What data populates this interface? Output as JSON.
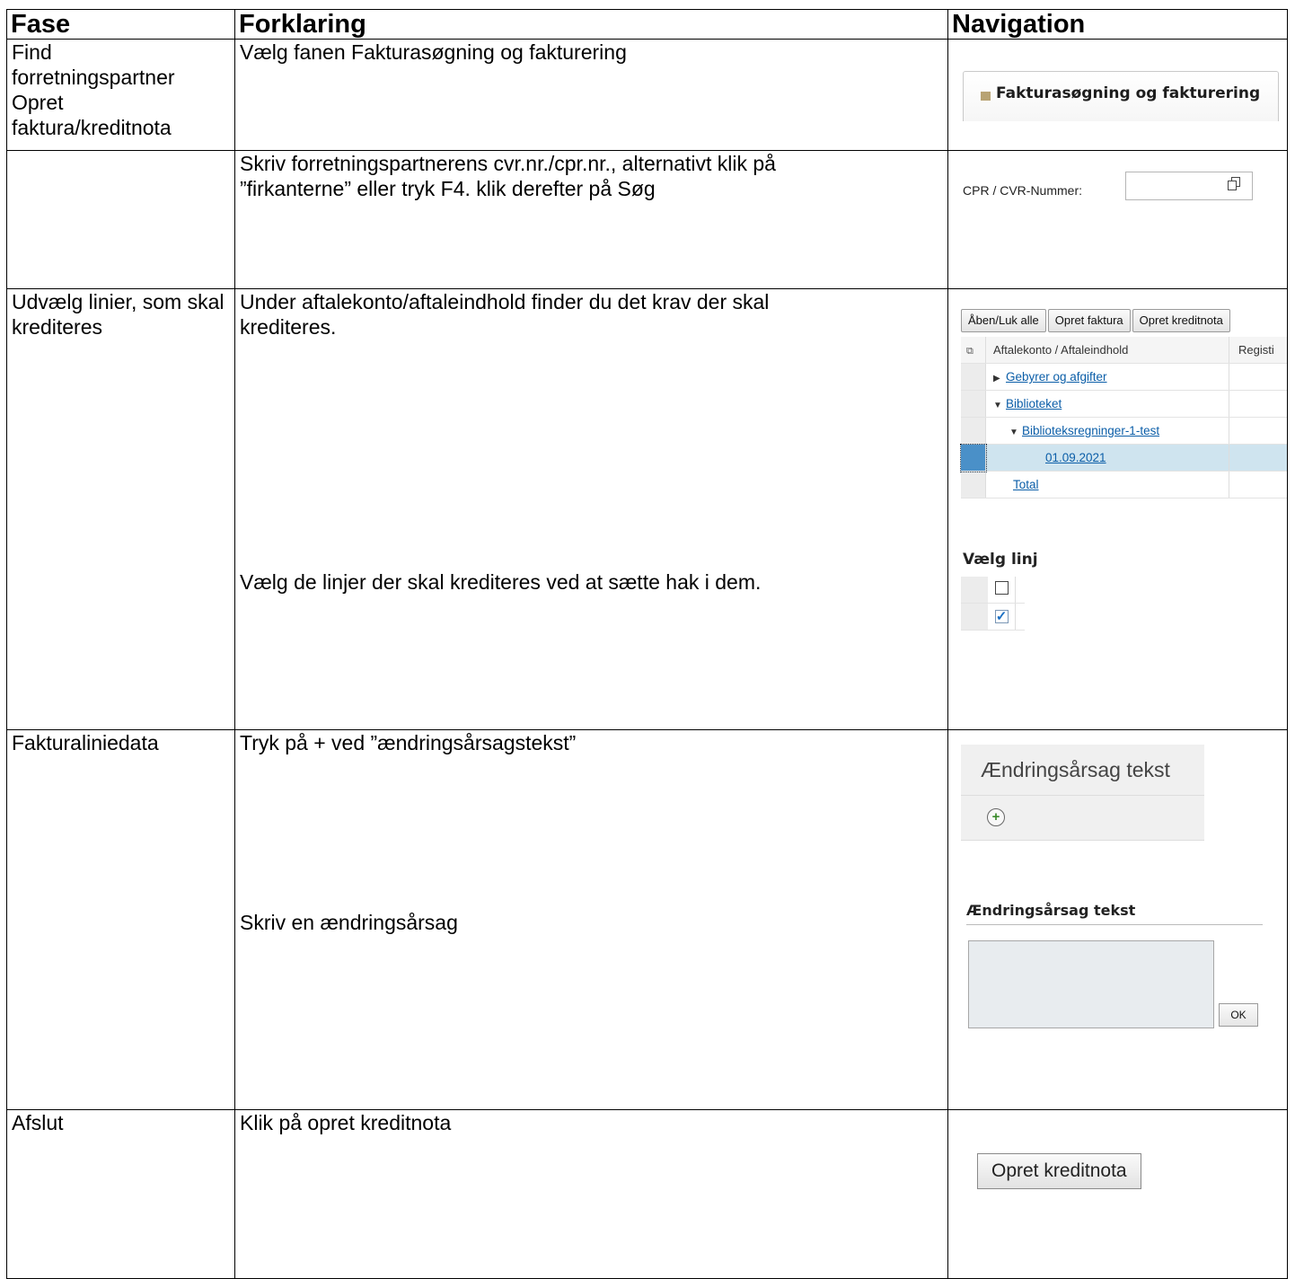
{
  "headers": {
    "fase": "Fase",
    "forklaring": "Forklaring",
    "navigation": "Navigation"
  },
  "rows": [
    {
      "fase": "Find forretningspartner Opret faktura/kreditnota",
      "forklaring": "Vælg fanen Fakturasøgning og fakturering"
    },
    {
      "fase": "",
      "forklaring": "Skriv forretningspartnerens cvr.nr./cpr.nr., alternativt klik på ”firkanterne” eller tryk F4. klik derefter på Søg"
    },
    {
      "fase": "Udvælg linier, som skal krediteres",
      "forklaring": "Under aftalekonto/aftaleindhold finder du det krav der skal krediteres.",
      "forklaring2": "Vælg de linjer der skal krediteres ved at sætte hak i dem."
    },
    {
      "fase": "Fakturaliniedata",
      "forklaring": "Tryk på + ved ”ændringsårsagstekst”",
      "forklaring2": "Skriv en ændringsårsag"
    },
    {
      "fase": "Afslut",
      "forklaring": "Klik på opret kreditnota"
    }
  ],
  "nav": {
    "tab_label": "Fakturasøgning og fakturering",
    "cpr_label": "CPR / CVR-Nummer:",
    "toolbar": [
      "Åben/Luk alle",
      "Opret faktura",
      "Opret kreditnota"
    ],
    "grid_headers": [
      "Aftalekonto / Aftaleindhold",
      "Registi"
    ],
    "grid_rows": [
      "Gebyrer og afgifter",
      "Biblioteket",
      "Biblioteksregninger-1-test",
      "01.09.2021",
      "Total"
    ],
    "vaelg_title": "Vælg linj",
    "aendring_header": "Ændringsårsag tekst",
    "aendring_title": "Ændringsårsag tekst",
    "ok_label": "OK",
    "kredit_button": "Opret kreditnota"
  },
  "colors": {
    "tab_icon": "#b8a373",
    "link": "#0b5ea8",
    "selected_row": "#cfe4ef",
    "plus_icon": "#3a8a2a"
  }
}
